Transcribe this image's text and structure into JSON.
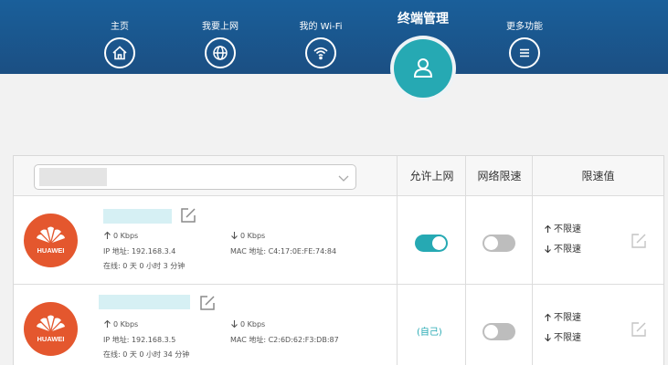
{
  "nav": {
    "items": [
      {
        "label": "主页",
        "icon": "home-icon"
      },
      {
        "label": "我要上网",
        "icon": "globe-icon"
      },
      {
        "label": "我的 Wi-Fi",
        "icon": "wifi-icon"
      },
      {
        "label": "更多功能",
        "icon": "menu-icon"
      }
    ],
    "active": {
      "label": "终端管理",
      "icon": "user-icon"
    }
  },
  "table": {
    "headers": {
      "allow": "允许上网",
      "limit": "网络限速",
      "speed": "限速值"
    },
    "devices": [
      {
        "logo_text": "HUAWEI",
        "up": "0 Kbps",
        "down": "0 Kbps",
        "ip": "IP 地址: 192.168.3.4",
        "mac": "MAC 地址: C4:17:0E:FE:74:84",
        "online": "在线: 0 天 0 小时 3 分钟",
        "allow_internet": true,
        "allow_label": "",
        "speed_limit_enabled": false,
        "up_limit": "不限速",
        "down_limit": "不限速"
      },
      {
        "logo_text": "HUAWEI",
        "up": "0 Kbps",
        "down": "0 Kbps",
        "ip": "IP 地址: 192.168.3.5",
        "mac": "MAC 地址: C2:6D:62:F3:DB:87",
        "online": "在线: 0 天 0 小时 34 分钟",
        "allow_internet": null,
        "allow_label": "(自己)",
        "speed_limit_enabled": false,
        "up_limit": "不限速",
        "down_limit": "不限速"
      }
    ]
  },
  "colors": {
    "header": "#1b4f83",
    "accent": "#26a9b3",
    "huawei": "#e4572e"
  }
}
